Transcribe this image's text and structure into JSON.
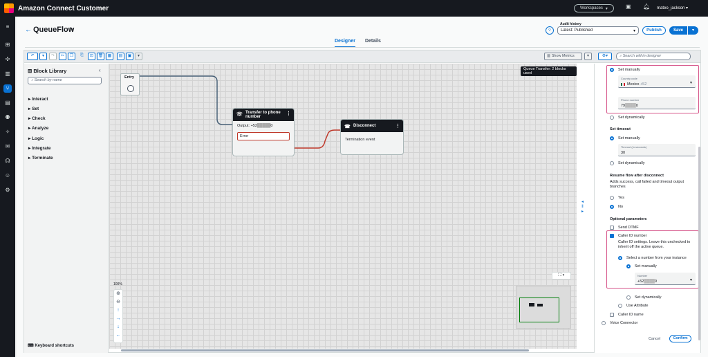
{
  "app": {
    "title": "Amazon Connect Customer",
    "workspaces_label": "Workspaces",
    "user": "mateo_jackson"
  },
  "header": {
    "flow_name": "QueueFlow",
    "audit_label": "Audit history",
    "audit_value": "Latest: Published",
    "publish_label": "Publish",
    "save_label": "Save"
  },
  "tabs": [
    {
      "label": "Designer"
    },
    {
      "label": "Details"
    }
  ],
  "toolbar": {
    "show_metrics": "Show Metrics",
    "search_placeholder": "Search within designer"
  },
  "library": {
    "title": "Block Library",
    "search_placeholder": "Search by name",
    "items": [
      {
        "label": "Interact"
      },
      {
        "label": "Set"
      },
      {
        "label": "Check"
      },
      {
        "label": "Analyze"
      },
      {
        "label": "Logic"
      },
      {
        "label": "Integrate"
      },
      {
        "label": "Terminate"
      }
    ],
    "keyboard_shortcuts": "Keyboard shortcuts"
  },
  "canvas": {
    "queue_badge": "Queue Transfer: 2 blocks used",
    "entry_label": "Entry",
    "zoom": "100%",
    "block_transfer": {
      "title": "Transfer to phone number",
      "output": "Output: +52",
      "output_suffix": "0",
      "error": "Error"
    },
    "block_disconnect": {
      "title": "Disconnect",
      "body": "Termination event"
    }
  },
  "panel": {
    "set_manually": "Set manually",
    "country_code_label": "Country code",
    "country_value": "Mexico",
    "country_dial": "+52",
    "phone_label": "Phone number",
    "phone_value_prefix": "79",
    "phone_value_suffix": "0",
    "set_dynamically": "Set dynamically",
    "set_timeout": "Set timeout",
    "timeout_set_manually": "Set manually",
    "timeout_label": "Timeout (in seconds)",
    "timeout_value": "30",
    "timeout_set_dynamically": "Set dynamically",
    "resume_title": "Resume flow after disconnect",
    "resume_desc": "Adds success, call failed and timeout output branches",
    "yes": "Yes",
    "no": "No",
    "optional_params": "Optional parameters",
    "send_dtmf": "Send DTMF",
    "caller_id_number": "Caller ID number",
    "caller_id_desc": "Caller ID settings. Leave this unchecked to inherit off the active queue.",
    "select_number": "Select a number from your instance",
    "cid_set_manually": "Set manually",
    "number_label": "Number",
    "number_prefix": "+52",
    "number_suffix": "9",
    "cid_set_dynamically": "Set dynamically",
    "use_attribute": "Use Attribute",
    "caller_id_name": "Caller ID name",
    "voice_connector": "Voice Connector",
    "cancel": "Cancel",
    "confirm": "Confirm"
  }
}
